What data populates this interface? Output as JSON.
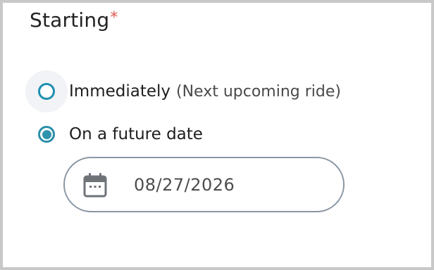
{
  "section": {
    "title": "Starting",
    "required_marker": "*"
  },
  "options": [
    {
      "label": "Immediately",
      "sublabel": "(Next upcoming ride)",
      "checked": false
    },
    {
      "label": "On a future date",
      "checked": true
    }
  ],
  "date_field": {
    "value": "08/27/2026",
    "icon": "calendar-icon"
  },
  "colors": {
    "accent": "#2f93ae",
    "required": "#e0574f",
    "field_border": "#8a96a3"
  }
}
